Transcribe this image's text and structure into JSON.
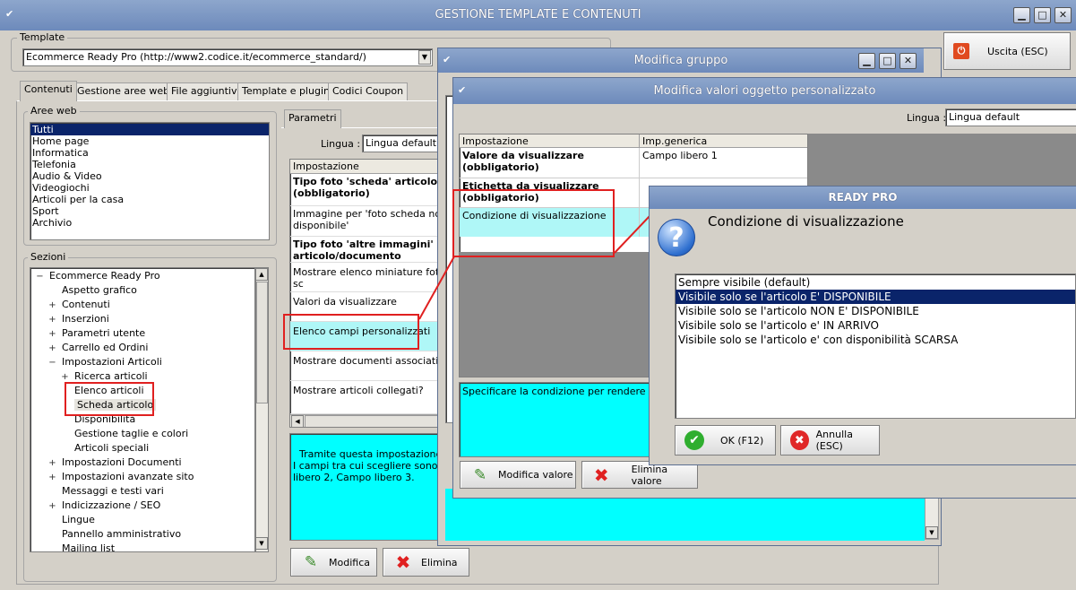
{
  "main": {
    "title": "GESTIONE TEMPLATE E CONTENUTI",
    "template_label": "Template",
    "template_value": "Ecommerce Ready Pro (http://www2.codice.it/ecommerce_standard/)",
    "exit_label": "Uscita (ESC)",
    "tabs": [
      "Contenuti",
      "Gestione aree web",
      "File aggiuntivi",
      "Template e plugins",
      "Codici Coupon"
    ],
    "aree_label": "Aree web",
    "aree": [
      "Tutti",
      "Home page",
      "Informatica",
      "Telefonia",
      "Audio & Video",
      "Videogiochi",
      "Articoli per la casa",
      "Sport",
      "Archivio"
    ],
    "sezioni_label": "Sezioni",
    "tree": [
      {
        "exp": "−",
        "label": "Ecommerce Ready Pro"
      },
      {
        "exp": "",
        "label": "Aspetto grafico"
      },
      {
        "exp": "+",
        "label": "Contenuti"
      },
      {
        "exp": "+",
        "label": "Inserzioni"
      },
      {
        "exp": "+",
        "label": "Parametri utente"
      },
      {
        "exp": "+",
        "label": "Carrello ed Ordini"
      },
      {
        "exp": "−",
        "label": "Impostazioni Articoli"
      },
      {
        "exp": "+",
        "label": "Ricerca articoli"
      },
      {
        "exp": "",
        "label": "Elenco articoli"
      },
      {
        "exp": "",
        "label": "Scheda articolo"
      },
      {
        "exp": "",
        "label": "Disponibilità"
      },
      {
        "exp": "",
        "label": "Gestione taglie e colori"
      },
      {
        "exp": "",
        "label": "Articoli speciali"
      },
      {
        "exp": "+",
        "label": "Impostazioni Documenti"
      },
      {
        "exp": "+",
        "label": "Impostazioni avanzate sito"
      },
      {
        "exp": "",
        "label": "Messaggi e testi vari"
      },
      {
        "exp": "+",
        "label": "Indicizzazione / SEO"
      },
      {
        "exp": "",
        "label": "Lingue"
      },
      {
        "exp": "",
        "label": "Pannello amministrativo"
      },
      {
        "exp": "",
        "label": "Mailing list"
      }
    ],
    "parametri_tab": "Parametri",
    "lingua_label": "Lingua :",
    "lingua_value": "Lingua default",
    "grid_header": "Impostazione",
    "grid_rows": [
      "Tipo foto 'scheda' articolo (obbligatorio)",
      "Immagine per 'foto scheda non disponibile'",
      "Tipo foto 'altre immagini' articolo/documento (obbliga",
      "Mostrare elenco miniature foto' sc",
      "Valori da visualizzare",
      "Elenco campi personalizzati",
      "Mostrare documenti associati?",
      "Mostrare articoli collegati?"
    ],
    "desc_text": "Tramite questa impostazione e' po\nI campi tra cui scegliere sono quel\nlibero 2, Campo libero 3.",
    "modifica_label": "Modifica",
    "elimina_label": "Elimina"
  },
  "gruppo": {
    "title": "Modifica gruppo"
  },
  "valori": {
    "title": "Modifica valori oggetto personalizzato",
    "lingua_label": "Lingua :",
    "lingua_value": "Lingua default",
    "col1": "Impostazione",
    "col2": "Imp.generica",
    "rows": [
      {
        "name": "Valore da visualizzare (obbligatorio)",
        "value": "Campo libero 1"
      },
      {
        "name": "Etichetta da visualizzare (obbligatorio)",
        "value": ""
      },
      {
        "name": "Condizione di visualizzazione",
        "value": ""
      }
    ],
    "desc_text": "Specificare la condizione per rendere il camp",
    "modifica_valore": "Modifica valore",
    "elimina_valore": "Elimina valore"
  },
  "dialog": {
    "title": "READY PRO",
    "heading": "Condizione di visualizzazione",
    "options": [
      "Sempre visibile (default)",
      "Visibile solo se l'articolo E' DISPONIBILE",
      "Visibile solo se l'articolo NON E' DISPONIBILE",
      "Visibile solo se l'articolo e' IN ARRIVO",
      "Visibile solo se l'articolo e' con disponibilità SCARSA"
    ],
    "selected_index": 1,
    "ok_label": "OK (F12)",
    "cancel_label": "Annulla (ESC)"
  },
  "colors": {
    "accent": "#0a246a",
    "highlight": "#00ffff",
    "annotation": "#e02020"
  }
}
